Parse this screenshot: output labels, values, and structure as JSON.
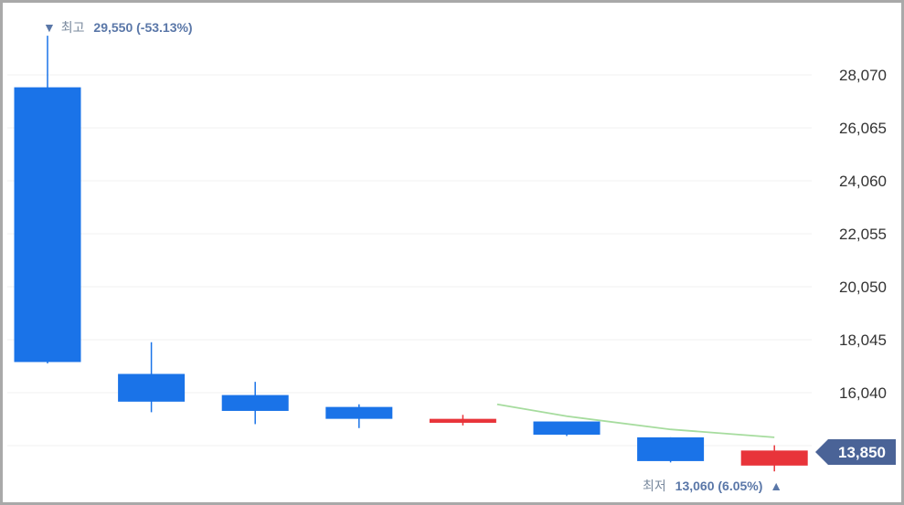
{
  "chart_data": {
    "type": "candlestick",
    "y_ticks": [
      "28,070",
      "26,065",
      "24,060",
      "22,055",
      "20,050",
      "18,045",
      "16,040"
    ],
    "ylim": [
      13000,
      30000
    ],
    "candles": [
      {
        "open": 27600,
        "high": 29550,
        "low": 17150,
        "close": 17200
      },
      {
        "open": 16750,
        "high": 17950,
        "low": 15300,
        "close": 15700
      },
      {
        "open": 15950,
        "high": 16450,
        "low": 14850,
        "close": 15350
      },
      {
        "open": 15500,
        "high": 15600,
        "low": 14700,
        "close": 15050
      },
      {
        "open": 14900,
        "high": 15200,
        "low": 14800,
        "close": 15050
      },
      {
        "open": 14950,
        "high": 14950,
        "low": 14400,
        "close": 14450
      },
      {
        "open": 14350,
        "high": 14350,
        "low": 13400,
        "close": 13450
      },
      {
        "open": 13280,
        "high": 14050,
        "low": 13060,
        "close": 13850
      }
    ],
    "moving_average": [
      {
        "index": 4.33,
        "value": 15600
      },
      {
        "index": 5,
        "value": 15150
      },
      {
        "index": 6,
        "value": 14650
      },
      {
        "index": 7,
        "value": 14350
      }
    ],
    "colors": {
      "down": "#1a73e8",
      "up": "#e8343a",
      "ma": "#a6dc9e",
      "annotation": "#5a77a8",
      "current_bg": "#4a6397"
    }
  },
  "annotations": {
    "high": {
      "marker": "▼",
      "label": "최고",
      "value": "29,550 (-53.13%)"
    },
    "low": {
      "label": "최저",
      "value": "13,060 (6.05%)",
      "marker": "▲"
    }
  },
  "current_price": "13,850"
}
